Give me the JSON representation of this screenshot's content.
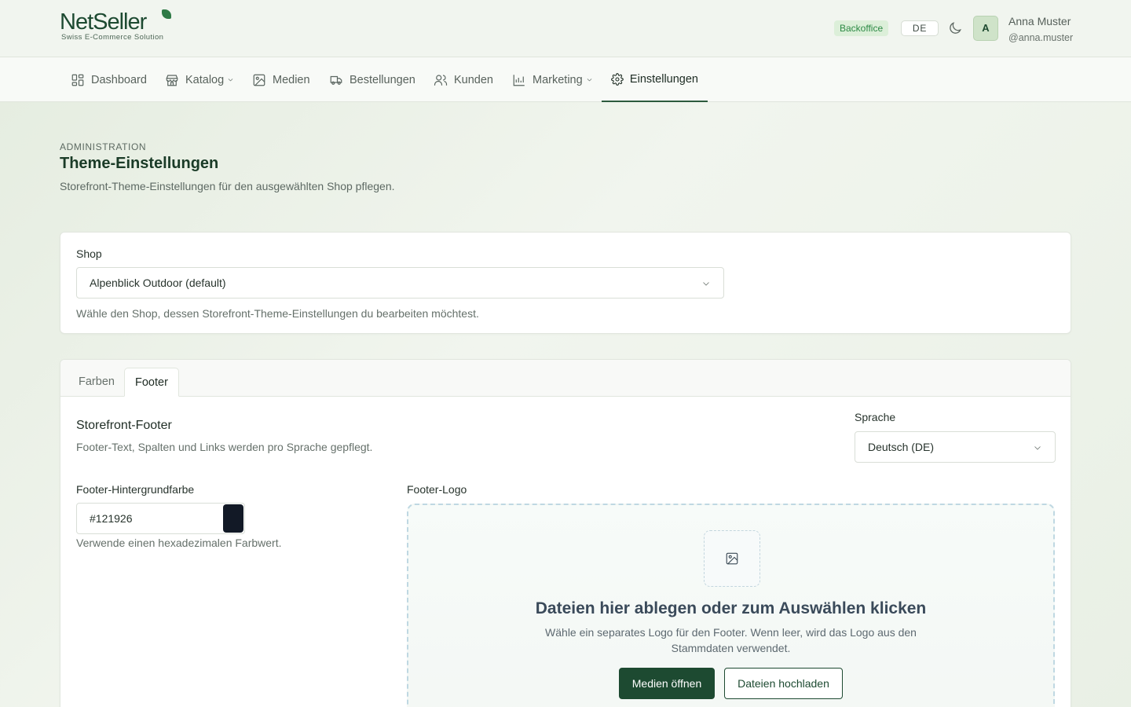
{
  "header": {
    "logo_net": "Net",
    "logo_seller": "Seller",
    "logo_tagline": "Swiss E-Commerce Solution",
    "badge": "Backoffice",
    "language": "DE",
    "user": {
      "initial": "A",
      "name": "Anna Muster",
      "handle": "@anna.muster"
    }
  },
  "nav": {
    "items": [
      {
        "label": "Dashboard",
        "icon": "dashboard-icon"
      },
      {
        "label": "Katalog",
        "icon": "store-icon",
        "dropdown": true
      },
      {
        "label": "Medien",
        "icon": "image-icon"
      },
      {
        "label": "Bestellungen",
        "icon": "truck-icon"
      },
      {
        "label": "Kunden",
        "icon": "users-icon"
      },
      {
        "label": "Marketing",
        "icon": "chart-icon",
        "dropdown": true
      },
      {
        "label": "Einstellungen",
        "icon": "gear-icon",
        "active": true
      }
    ]
  },
  "page": {
    "kicker": "ADMINISTRATION",
    "title": "Theme-Einstellungen",
    "description": "Storefront-Theme-Einstellungen für den ausgewählten Shop pflegen."
  },
  "shop": {
    "label": "Shop",
    "selected": "Alpenblick Outdoor (default)",
    "help": "Wähle den Shop, dessen Storefront-Theme-Einstellungen du bearbeiten möchtest."
  },
  "tabs": [
    {
      "label": "Farben",
      "active": false
    },
    {
      "label": "Footer",
      "active": true
    }
  ],
  "footer_section": {
    "title": "Storefront-Footer",
    "description": "Footer-Text, Spalten und Links werden pro Sprache gepflegt.",
    "language_label": "Sprache",
    "language_value": "Deutsch (DE)",
    "bg_label": "Footer-Hintergrundfarbe",
    "bg_value": "#121926",
    "bg_help": "Verwende einen hexadezimalen Farbwert.",
    "logo_label": "Footer-Logo",
    "dropzone_title": "Dateien hier ablegen oder zum Auswählen klicken",
    "dropzone_desc": "Wähle ein separates Logo für den Footer. Wenn leer, wird das Logo aus den Stammdaten verwendet.",
    "btn_media": "Medien öffnen",
    "btn_upload": "Dateien hochladen"
  },
  "colors": {
    "brand": "#1d4a31",
    "swatch": "#121926",
    "badge_bg": "#dcefd9",
    "badge_text": "#2d8a45"
  }
}
